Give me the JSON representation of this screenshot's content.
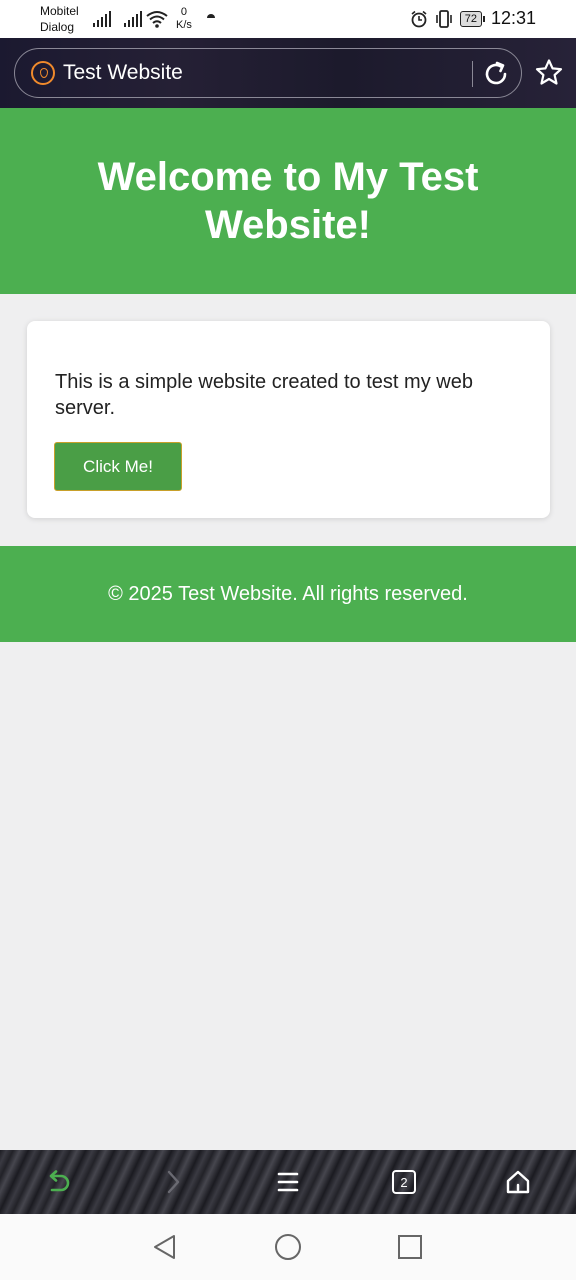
{
  "status_bar": {
    "carrier_1": "Mobitel",
    "carrier_2": "Dialog",
    "net_speed_value": "0",
    "net_speed_unit": "K/s",
    "battery": "72",
    "time": "12:31"
  },
  "browser": {
    "address_title": "Test Website",
    "tab_count": "2",
    "icons": {
      "site": "site-favicon-icon",
      "reload": "reload-icon",
      "bookmark": "star-icon",
      "back": "back-arrow-icon",
      "forward": "forward-chevron-icon",
      "menu": "menu-icon",
      "tabs": "tabs-icon",
      "home": "home-icon"
    },
    "colors": {
      "back_arrow": "#4caf50",
      "site_icon": "#f08a2c"
    }
  },
  "page": {
    "header_title": "Welcome to My Test Website!",
    "card_text": "This is a simple website created to test my web server.",
    "button_label": "Click Me!",
    "footer_text": "© 2025 Test Website. All rights reserved.",
    "colors": {
      "accent": "#4caf50",
      "button": "#4a9e46",
      "background": "#efeff0"
    }
  },
  "system_nav": {
    "icons": [
      "back-triangle-icon",
      "home-circle-icon",
      "recents-square-icon"
    ]
  }
}
